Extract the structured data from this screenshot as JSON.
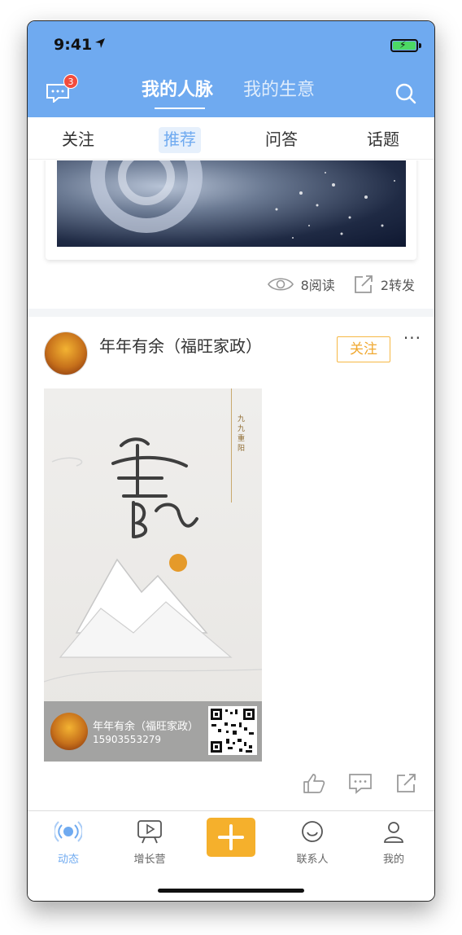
{
  "status_bar": {
    "time": "9:41"
  },
  "header": {
    "message_badge": "3",
    "tabs": [
      {
        "label": "我的人脉",
        "active": true
      },
      {
        "label": "我的生意",
        "active": false
      }
    ]
  },
  "sub_tabs": [
    {
      "label": "关注"
    },
    {
      "label": "推荐",
      "active": true
    },
    {
      "label": "问答"
    },
    {
      "label": "话题"
    }
  ],
  "prev_post": {
    "views": "8阅读",
    "shares": "2转发"
  },
  "post": {
    "author": "年年有余（福旺家政）",
    "follow_label": "关注",
    "more": "···",
    "poster": {
      "name": "年年有余（福旺家政）",
      "phone": "15903553279"
    }
  },
  "bottom_nav": {
    "items": [
      {
        "label": "动态",
        "icon": "broadcast-icon",
        "active": true
      },
      {
        "label": "增长营",
        "icon": "video-board-icon"
      },
      {
        "label": "联系人",
        "icon": "smile-icon"
      },
      {
        "label": "我的",
        "icon": "person-icon"
      }
    ]
  },
  "colors": {
    "primary": "#6faaf0",
    "accent": "#f5b02c",
    "badge": "#f24c3d"
  }
}
